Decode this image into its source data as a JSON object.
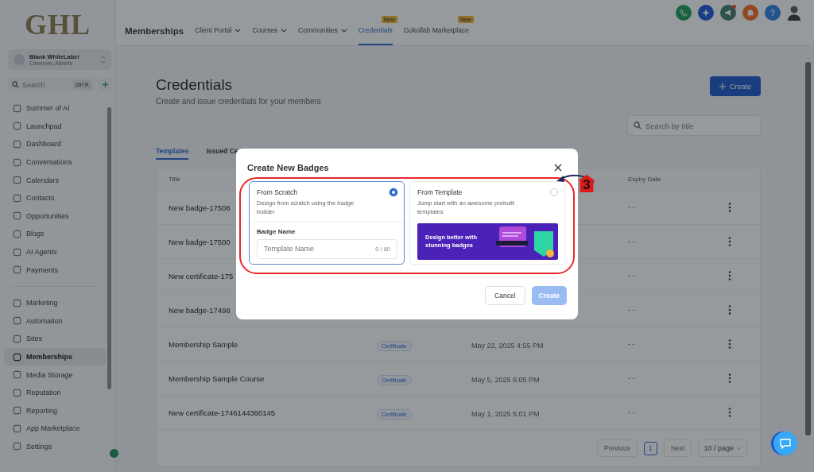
{
  "sidebar": {
    "logo": "GHL",
    "account": {
      "name": "Blank WhiteLabel",
      "location": "Canmore, Alberta"
    },
    "search": {
      "placeholder": "Search",
      "shortcut": "ctrl K"
    },
    "groups": [
      {
        "items": [
          {
            "label": "Summer of AI",
            "selected": false
          },
          {
            "label": "Launchpad",
            "selected": false
          },
          {
            "label": "Dashboard",
            "selected": false
          },
          {
            "label": "Conversations",
            "selected": false
          },
          {
            "label": "Calendars",
            "selected": false
          },
          {
            "label": "Contacts",
            "selected": false
          },
          {
            "label": "Opportunities",
            "selected": false
          },
          {
            "label": "Blogs",
            "selected": false
          },
          {
            "label": "AI Agents",
            "selected": false
          },
          {
            "label": "Payments",
            "selected": false
          }
        ]
      },
      {
        "items": [
          {
            "label": "Marketing",
            "selected": false
          },
          {
            "label": "Automation",
            "selected": false
          },
          {
            "label": "Sites",
            "selected": false
          },
          {
            "label": "Memberships",
            "selected": true
          },
          {
            "label": "Media Storage",
            "selected": false
          },
          {
            "label": "Reputation",
            "selected": false
          },
          {
            "label": "Reporting",
            "selected": false
          },
          {
            "label": "App Marketplace",
            "selected": false
          },
          {
            "label": "Settings",
            "selected": false
          }
        ]
      }
    ]
  },
  "topbar": {
    "title": "Memberships",
    "tabs": [
      {
        "label": "Client Portal",
        "dropdown": true,
        "selected": false
      },
      {
        "label": "Courses",
        "dropdown": true,
        "selected": false
      },
      {
        "label": "Communities",
        "dropdown": true,
        "selected": false
      },
      {
        "label": "Credentials",
        "dropdown": false,
        "selected": true,
        "badge": "New"
      },
      {
        "label": "Gokollab Marketplace",
        "dropdown": false,
        "selected": false,
        "badge": "New"
      }
    ]
  },
  "page": {
    "title": "Credentials",
    "subtitle": "Create and issue credentials for your members",
    "create_button": "Create",
    "search": {
      "placeholder": "Search by title"
    },
    "tabs": [
      {
        "label": "Templates",
        "selected": true
      },
      {
        "label": "Issued Ce",
        "selected": false
      }
    ],
    "table": {
      "columns": {
        "title": "Title",
        "expiry": "Expiry Date"
      },
      "rows": [
        {
          "title": "New badge-17508",
          "expiry": "- -"
        },
        {
          "title": "New badge-17500",
          "expiry": "- -"
        },
        {
          "title": "New certificate-175",
          "expiry": "- -"
        },
        {
          "title": "New badge-17498",
          "expiry": "- -"
        },
        {
          "title": "Membership Sample",
          "type": "Certificate",
          "created": "May 22, 2025 4:55 PM",
          "expiry": "- -"
        },
        {
          "title": "Membership Sample Course",
          "type": "Certificate",
          "created": "May 5, 2025 6:05 PM",
          "expiry": "- -"
        },
        {
          "title": "New certificate-1746144360145",
          "type": "Certificate",
          "created": "May 1, 2025 5:01 PM",
          "expiry": "- -"
        }
      ]
    },
    "pagination": {
      "previous": "Previous",
      "pages": [
        {
          "label": "1",
          "selected": true
        }
      ],
      "next": "Next",
      "page_size": "10 / page"
    }
  },
  "modal": {
    "title": "Create New Badges",
    "options": [
      {
        "kind": "scratch",
        "title": "From Scratch",
        "description": "Design from scratch using the badge builder",
        "selected": true,
        "field_label": "Badge Name",
        "placeholder": "Template Name",
        "counter": "0 / 80"
      },
      {
        "kind": "template",
        "title": "From Template",
        "description": "Jump start with an awesome prebuilt templates",
        "selected": false,
        "banner_text": "Design better with stunning badges"
      }
    ],
    "cancel": "Cancel",
    "create": "Create",
    "create_disabled": true
  },
  "annotation": {
    "label": "3"
  }
}
